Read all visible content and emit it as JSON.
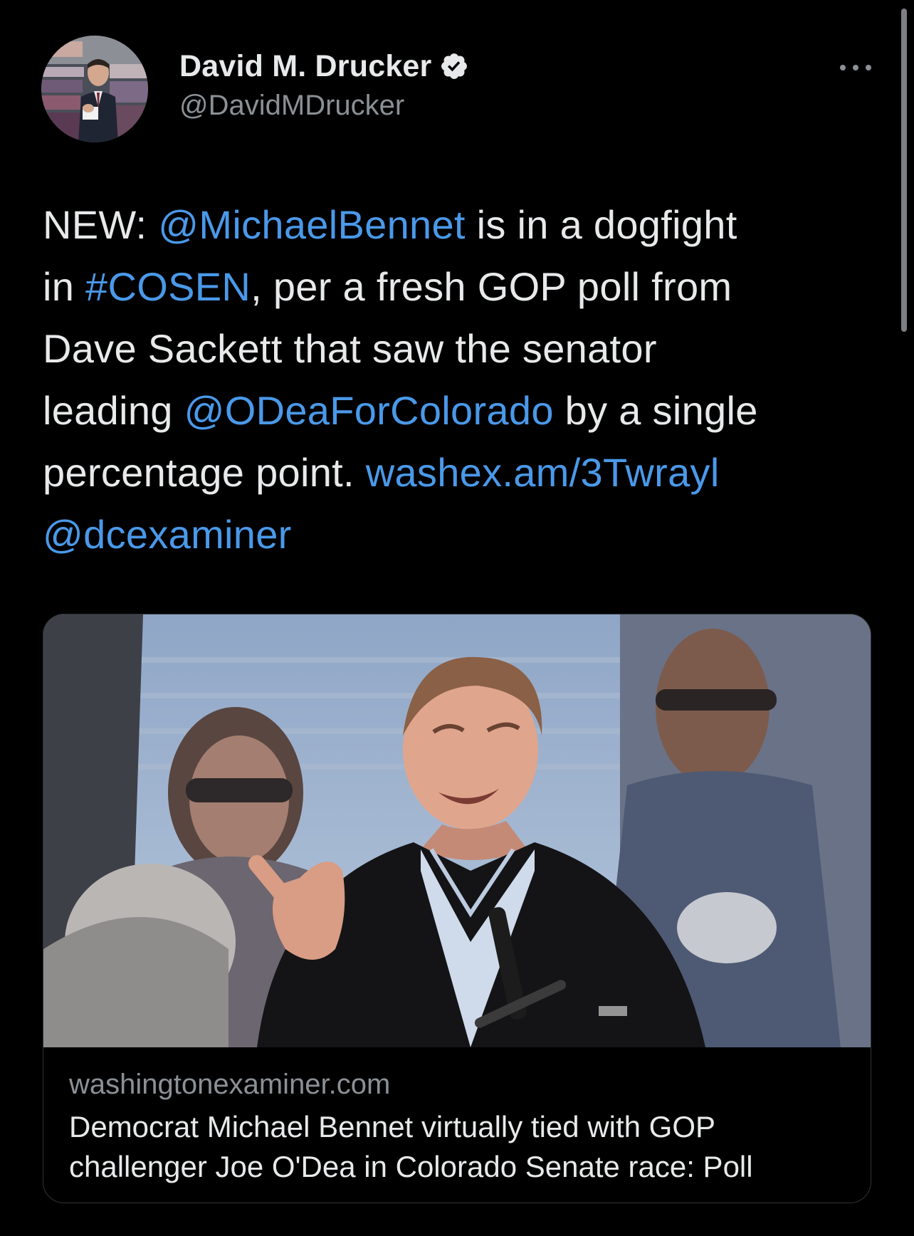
{
  "author": {
    "display_name": "David M. Drucker",
    "handle": "@DavidMDrucker",
    "verified": true,
    "avatar_icon": "avatar-photo"
  },
  "menu": {
    "icon": "more-options-icon"
  },
  "tweet": {
    "lines": [
      [
        {
          "text": "NEW: ",
          "link": false
        },
        {
          "text": "@MichaelBennet",
          "link": true
        },
        {
          "text": " is in a dogfight",
          "link": false
        }
      ],
      [
        {
          "text": "in ",
          "link": false
        },
        {
          "text": "#COSEN",
          "link": true
        },
        {
          "text": ", per a fresh GOP poll from",
          "link": false
        }
      ],
      [
        {
          "text": "Dave Sackett that saw the senator",
          "link": false
        }
      ],
      [
        {
          "text": "leading ",
          "link": false
        },
        {
          "text": "@ODeaForColorado",
          "link": true
        },
        {
          "text": " by a single",
          "link": false
        }
      ],
      [
        {
          "text": "percentage point. ",
          "link": false
        },
        {
          "text": "washex.am/3Twrayl",
          "link": true
        }
      ],
      [
        {
          "text": "@dcexaminer",
          "link": true
        }
      ]
    ]
  },
  "link_card": {
    "domain": "washingtonexaminer.com",
    "title_lines": [
      "Democrat Michael Bennet virtually tied with GOP",
      "challenger Joe O'Dea in Colorado Senate race: Poll"
    ]
  },
  "colors": {
    "background": "#000000",
    "text": "#e7e9ea",
    "secondary_text": "#8b9096",
    "link": "#4a99e9",
    "verified_badge": "#e7e9ea"
  }
}
